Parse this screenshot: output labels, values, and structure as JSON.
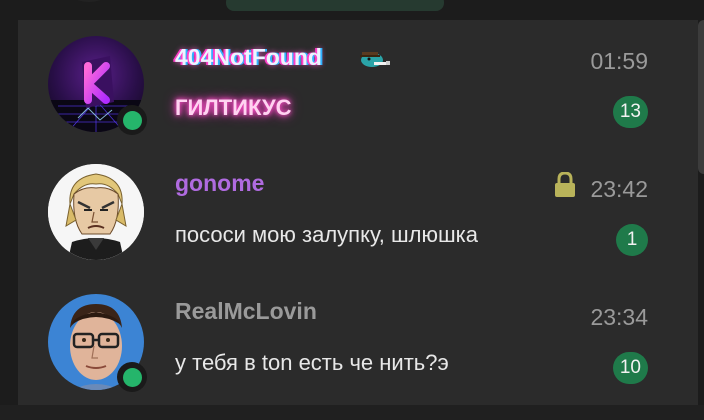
{
  "chats": [
    {
      "name": "404NotFound",
      "preview": "ГИЛТИКУС",
      "time": "01:59",
      "unread": "13",
      "online": true,
      "name_color": "#eef3ff",
      "avatar_icon": "neon-k-logo-icon",
      "name_icon": "platypus-sticker-icon"
    },
    {
      "name": "gonome",
      "preview": "пососи мою залупку, шлюшка",
      "time": "23:42",
      "unread": "1",
      "online": false,
      "name_color": "#b06be0",
      "avatar_icon": "anime-character-avatar-icon",
      "status_icon": "lock-icon"
    },
    {
      "name": "RealMcLovin",
      "preview": "у тебя в ton есть че нить?э",
      "time": "23:34",
      "unread": "10",
      "online": true,
      "name_color": "#9a9a9a",
      "avatar_icon": "glasses-boy-avatar-icon"
    }
  ],
  "colors": {
    "panel_bg": "#2b2b2b",
    "page_bg": "#1c1c1c",
    "badge_bg": "#1f7a4a",
    "online": "#25b56b",
    "lock": "#b9b35a"
  }
}
